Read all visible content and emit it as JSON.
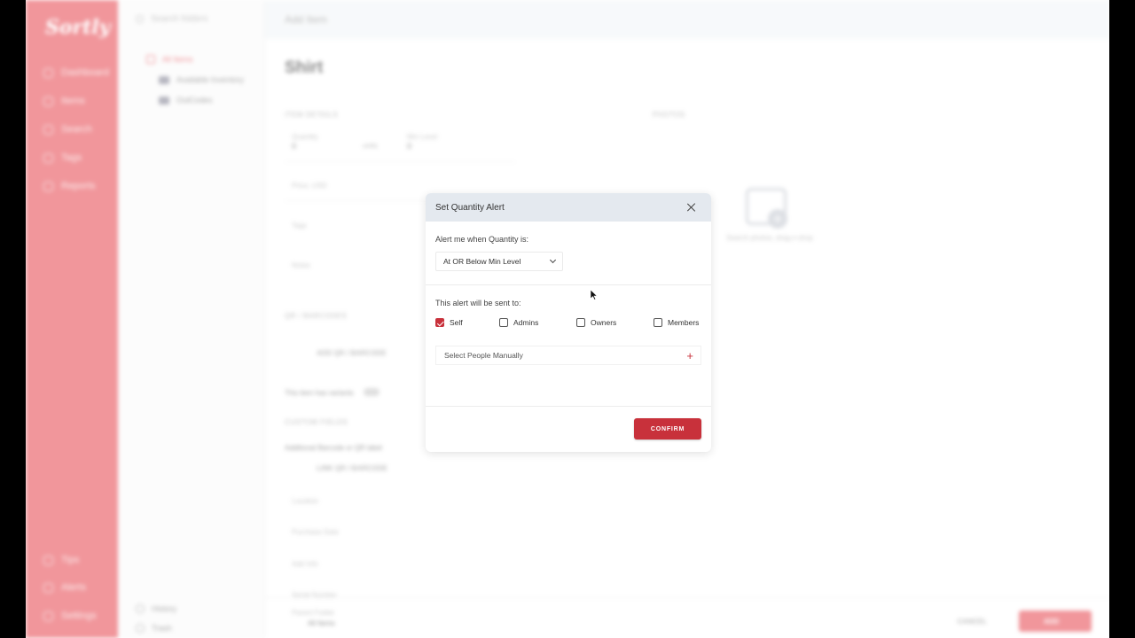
{
  "app": {
    "logo": "Sortly",
    "nav": [
      "Dashboard",
      "Items",
      "Search",
      "Tags",
      "Reports"
    ],
    "nav_bottom": [
      "Tips",
      "Alerts",
      "Settings"
    ]
  },
  "folders": {
    "search_placeholder": "Search folders",
    "tree": [
      "All Items",
      "Available Inventory",
      "OutCodes"
    ],
    "bottom": [
      "History",
      "Trash"
    ]
  },
  "page": {
    "breadcrumb": "Add Item",
    "title": "Shirt",
    "section_item_details": "ITEM DETAILS",
    "section_photos": "PHOTOS",
    "quantity_label": "Quantity",
    "quantity_value": "0",
    "units": "units",
    "min_level_label": "Min Level",
    "min_level_value": "0",
    "price_label": "Price, USD",
    "tags_label": "Tags",
    "notes_label": "Notes",
    "photo_hint": "Search photos, drag-n-drop",
    "section_qr": "QR / BARCODES",
    "add_qr": "ADD QR / BARCODE",
    "variants": "This item has variants",
    "section_custom": "CUSTOM FIELDS",
    "additional_barcode": "Additional Barcode or QR label",
    "link_qr": "LINK QR / BARCODE",
    "location": "Location",
    "purchase_date": "Purchase Date",
    "add_info": "Add Info",
    "serial_number": "Serial Number",
    "parent_folder_label": "Parent Folder",
    "parent_folder_value": "All Items",
    "cancel": "CANCEL",
    "add": "ADD"
  },
  "dialog": {
    "title": "Set Quantity Alert",
    "alert_label": "Alert me when Quantity is:",
    "condition": "At OR Below Min Level",
    "sent_to_label": "This alert will be sent to:",
    "recipients": [
      {
        "label": "Self",
        "checked": true
      },
      {
        "label": "Admins",
        "checked": false
      },
      {
        "label": "Owners",
        "checked": false
      },
      {
        "label": "Members",
        "checked": false
      }
    ],
    "people_placeholder": "Select People Manually",
    "confirm": "CONFIRM",
    "accent": "#c8313b"
  }
}
